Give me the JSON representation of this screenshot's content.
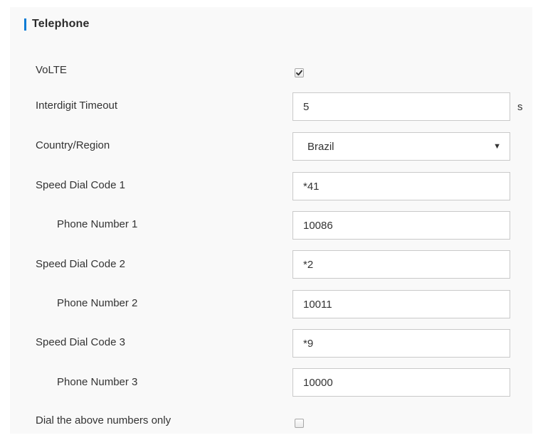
{
  "section": {
    "title": "Telephone"
  },
  "volte": {
    "label": "VoLTE",
    "checked": true
  },
  "interdigit_timeout": {
    "label": "Interdigit Timeout",
    "value": "5",
    "unit": "s"
  },
  "country_region": {
    "label": "Country/Region",
    "selected": "Brazil"
  },
  "speed_dials": [
    {
      "code_label": "Speed Dial Code 1",
      "code_value": "*41",
      "phone_label": "Phone Number 1",
      "phone_value": "10086"
    },
    {
      "code_label": "Speed Dial Code 2",
      "code_value": "*2",
      "phone_label": "Phone Number 2",
      "phone_value": "10011"
    },
    {
      "code_label": "Speed Dial Code 3",
      "code_value": "*9",
      "phone_label": "Phone Number 3",
      "phone_value": "10000"
    }
  ],
  "dial_only": {
    "label": "Dial the above numbers only",
    "checked": false
  },
  "colors": {
    "accent": "#0c7cd5",
    "panel_background": "#f9f9f9",
    "input_border": "#c9c9c9",
    "text": "#333333"
  },
  "icons": {
    "checkbox_check": "check-icon",
    "select_arrow": "caret-down-icon"
  }
}
